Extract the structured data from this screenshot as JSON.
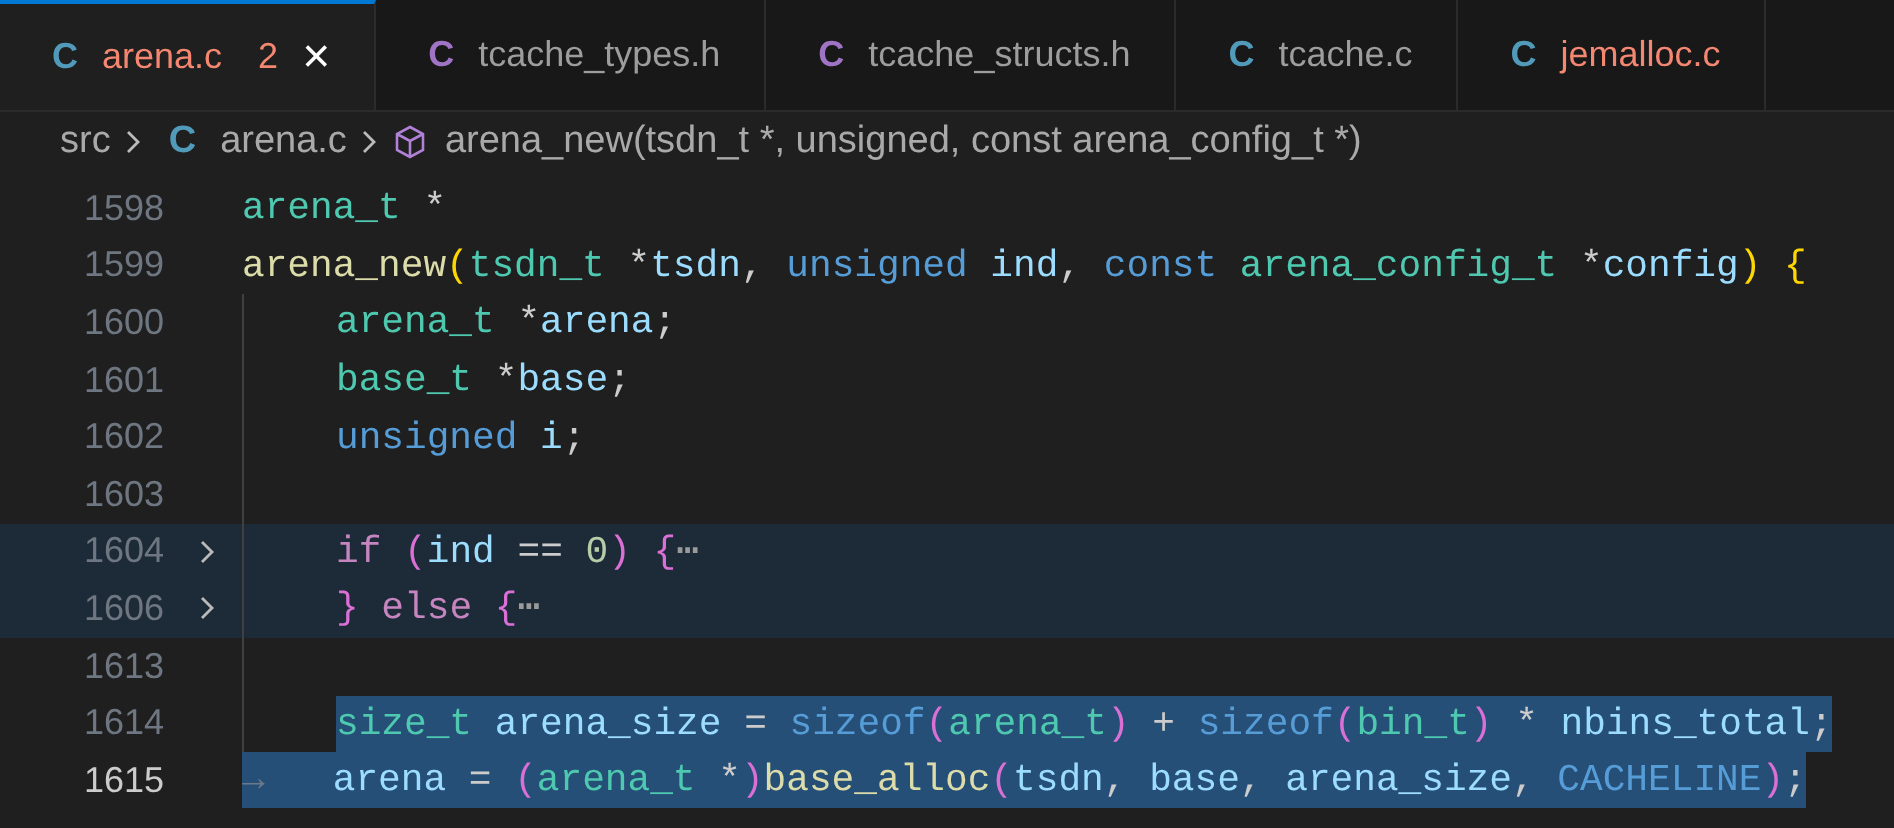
{
  "tabs": [
    {
      "icon": "C",
      "color": "#519aba",
      "label": "arena.c",
      "problems": "2",
      "close": "×",
      "selected": true,
      "error": true
    },
    {
      "icon": "C",
      "color": "#a074c4",
      "label": "tcache_types.h",
      "selected": false,
      "error": false
    },
    {
      "icon": "C",
      "color": "#a074c4",
      "label": "tcache_structs.h",
      "selected": false,
      "error": false
    },
    {
      "icon": "C",
      "color": "#519aba",
      "label": "tcache.c",
      "selected": false,
      "error": false
    },
    {
      "icon": "C",
      "color": "#519aba",
      "label": "jemalloc.c",
      "selected": false,
      "error": true
    }
  ],
  "breadcrumb": {
    "folder": "src",
    "file_icon": "C",
    "file": "arena.c",
    "symbol": "arena_new(tsdn_t *, unsigned, const arena_config_t *)"
  },
  "lines": [
    {
      "number": "1598",
      "in_block": false,
      "folded": false,
      "fold_region": false,
      "selected": false,
      "current": false,
      "tokens": [
        {
          "kind": "type",
          "text": "arena_t"
        },
        {
          "kind": "plain",
          "text": " *"
        }
      ]
    },
    {
      "number": "1599",
      "in_block": false,
      "folded": false,
      "fold_region": false,
      "selected": false,
      "current": false,
      "tokens": [
        {
          "kind": "func",
          "text": "arena_new"
        },
        {
          "kind": "paren1",
          "text": "("
        },
        {
          "kind": "type",
          "text": "tsdn_t"
        },
        {
          "kind": "plain",
          "text": " *"
        },
        {
          "kind": "var",
          "text": "tsdn"
        },
        {
          "kind": "plain",
          "text": ", "
        },
        {
          "kind": "keyword",
          "text": "unsigned"
        },
        {
          "kind": "var",
          "text": " ind"
        },
        {
          "kind": "plain",
          "text": ", "
        },
        {
          "kind": "keyword",
          "text": "const"
        },
        {
          "kind": "type",
          "text": " arena_config_t"
        },
        {
          "kind": "plain",
          "text": " *"
        },
        {
          "kind": "var",
          "text": "config"
        },
        {
          "kind": "paren1",
          "text": ")"
        },
        {
          "kind": "paren1",
          "text": " {"
        }
      ]
    },
    {
      "number": "1600",
      "in_block": true,
      "folded": false,
      "fold_region": false,
      "selected": false,
      "current": false,
      "tokens": [
        {
          "kind": "type",
          "text": "arena_t"
        },
        {
          "kind": "plain",
          "text": " *"
        },
        {
          "kind": "var",
          "text": "arena"
        },
        {
          "kind": "plain",
          "text": ";"
        }
      ]
    },
    {
      "number": "1601",
      "in_block": true,
      "folded": false,
      "fold_region": false,
      "selected": false,
      "current": false,
      "tokens": [
        {
          "kind": "type",
          "text": "base_t"
        },
        {
          "kind": "plain",
          "text": " *"
        },
        {
          "kind": "var",
          "text": "base"
        },
        {
          "kind": "plain",
          "text": ";"
        }
      ]
    },
    {
      "number": "1602",
      "in_block": true,
      "folded": false,
      "fold_region": false,
      "selected": false,
      "current": false,
      "tokens": [
        {
          "kind": "keyword",
          "text": "unsigned"
        },
        {
          "kind": "var",
          "text": " i"
        },
        {
          "kind": "plain",
          "text": ";"
        }
      ]
    },
    {
      "number": "1603",
      "in_block": true,
      "folded": false,
      "fold_region": false,
      "selected": false,
      "current": false
    },
    {
      "number": "1604",
      "in_block": true,
      "folded": true,
      "fold_region": true,
      "selected": false,
      "current": false,
      "tokens": [
        {
          "kind": "control",
          "text": "if"
        },
        {
          "kind": "paren2",
          "text": " ("
        },
        {
          "kind": "var",
          "text": "ind"
        },
        {
          "kind": "plain",
          "text": " == "
        },
        {
          "kind": "number",
          "text": "0"
        },
        {
          "kind": "paren2",
          "text": ")"
        },
        {
          "kind": "paren2",
          "text": " {"
        },
        {
          "kind": "ellipsis",
          "text": "⋯"
        }
      ]
    },
    {
      "number": "1606",
      "in_block": true,
      "folded": true,
      "fold_region": true,
      "selected": false,
      "current": false,
      "tokens": [
        {
          "kind": "paren2",
          "text": "}"
        },
        {
          "kind": "control",
          "text": " else"
        },
        {
          "kind": "paren2",
          "text": " {"
        },
        {
          "kind": "ellipsis",
          "text": "⋯"
        }
      ]
    },
    {
      "number": "1613",
      "in_block": true,
      "folded": false,
      "fold_region": false,
      "selected": false,
      "current": false
    },
    {
      "number": "1614",
      "in_block": true,
      "folded": false,
      "fold_region": false,
      "selected": true,
      "current": false,
      "tokens": [
        {
          "kind": "type",
          "text": "size_t"
        },
        {
          "kind": "var",
          "text": " arena_size"
        },
        {
          "kind": "plain",
          "text": " = "
        },
        {
          "kind": "keyword",
          "text": "sizeof"
        },
        {
          "kind": "paren2",
          "text": "("
        },
        {
          "kind": "type",
          "text": "arena_t"
        },
        {
          "kind": "paren2",
          "text": ")"
        },
        {
          "kind": "plain",
          "text": " + "
        },
        {
          "kind": "keyword",
          "text": "sizeof"
        },
        {
          "kind": "paren2",
          "text": "("
        },
        {
          "kind": "type",
          "text": "bin_t"
        },
        {
          "kind": "paren2",
          "text": ")"
        },
        {
          "kind": "plain",
          "text": " * "
        },
        {
          "kind": "var",
          "text": "nbins_total"
        },
        {
          "kind": "plain",
          "text": ";"
        }
      ]
    },
    {
      "number": "1615",
      "in_block": false,
      "folded": false,
      "fold_region": false,
      "selected": true,
      "current": true,
      "tokens": [
        {
          "kind": "whitespace",
          "text": "→   "
        },
        {
          "kind": "var",
          "text": "arena"
        },
        {
          "kind": "plain",
          "text": " = "
        },
        {
          "kind": "paren2",
          "text": "("
        },
        {
          "kind": "type",
          "text": "arena_t"
        },
        {
          "kind": "plain",
          "text": " *"
        },
        {
          "kind": "paren2",
          "text": ")"
        },
        {
          "kind": "func",
          "text": "base_alloc"
        },
        {
          "kind": "paren2",
          "text": "("
        },
        {
          "kind": "var",
          "text": "tsdn"
        },
        {
          "kind": "plain",
          "text": ", "
        },
        {
          "kind": "var",
          "text": "base"
        },
        {
          "kind": "plain",
          "text": ", "
        },
        {
          "kind": "var",
          "text": "arena_size"
        },
        {
          "kind": "plain",
          "text": ", "
        },
        {
          "kind": "keyword",
          "text": "CACHELINE"
        },
        {
          "kind": "paren2",
          "text": ")"
        },
        {
          "kind": "plain",
          "text": ";"
        }
      ]
    }
  ]
}
